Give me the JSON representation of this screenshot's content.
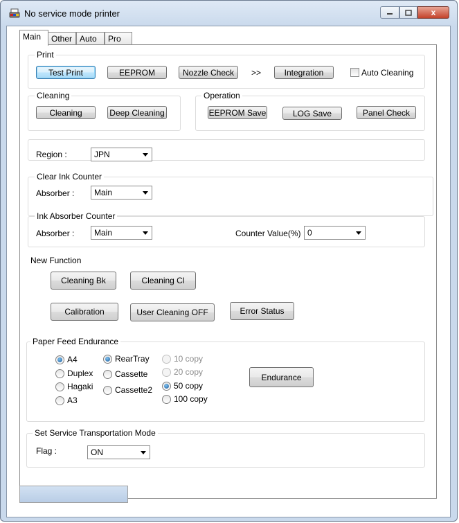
{
  "window": {
    "title": "No service mode printer",
    "minimize_icon": "minimize-icon",
    "maximize_icon": "maximize-icon",
    "close_icon": "close-icon",
    "close_glyph": "x"
  },
  "tabs": [
    {
      "label": "Main",
      "active": true
    },
    {
      "label": "Other",
      "active": false
    },
    {
      "label": "Auto",
      "active": false
    },
    {
      "label": "Pro",
      "active": false
    }
  ],
  "print": {
    "legend": "Print",
    "test_print": "Test Print",
    "eeprom": "EEPROM",
    "nozzle_check": "Nozzle Check",
    "arrows": ">>",
    "integration": "Integration",
    "auto_cleaning": "Auto Cleaning",
    "auto_cleaning_checked": false
  },
  "cleaning": {
    "legend": "Cleaning",
    "cleaning": "Cleaning",
    "deep_cleaning": "Deep Cleaning"
  },
  "operation": {
    "legend": "Operation",
    "eeprom_save": "EEPROM Save",
    "log_save": "LOG Save",
    "panel_check": "Panel Check"
  },
  "region": {
    "label": "Region :",
    "value": "JPN"
  },
  "clear_ink_counter": {
    "legend": "Clear Ink Counter",
    "absorber_label": "Absorber :",
    "absorber_value": "Main"
  },
  "ink_absorber_counter": {
    "legend": "Ink Absorber Counter",
    "absorber_label": "Absorber :",
    "absorber_value": "Main",
    "counter_label": "Counter Value(%) :",
    "counter_value": "0"
  },
  "new_function": {
    "label": "New Function",
    "cleaning_bk": "Cleaning Bk",
    "cleaning_cl": "Cleaning Cl",
    "calibration": "Calibration",
    "user_cleaning_off": "User Cleaning OFF",
    "error_status": "Error Status"
  },
  "paper_feed": {
    "legend": "Paper Feed Endurance",
    "sizes": [
      {
        "label": "A4",
        "checked": true
      },
      {
        "label": "Duplex",
        "checked": false
      },
      {
        "label": "Hagaki",
        "checked": false
      },
      {
        "label": "A3",
        "checked": false
      }
    ],
    "trays": [
      {
        "label": "RearTray",
        "checked": true
      },
      {
        "label": "Cassette",
        "checked": false
      },
      {
        "label": "Cassette2",
        "checked": false
      }
    ],
    "copies": [
      {
        "label": "10 copy",
        "checked": false,
        "disabled": true
      },
      {
        "label": "20 copy",
        "checked": false,
        "disabled": true
      },
      {
        "label": "50 copy",
        "checked": true,
        "disabled": false
      },
      {
        "label": "100 copy",
        "checked": false,
        "disabled": false
      }
    ],
    "endurance": "Endurance"
  },
  "transport": {
    "legend": "Set Service Transportation Mode",
    "flag_label": "Flag :",
    "flag_value": "ON"
  }
}
